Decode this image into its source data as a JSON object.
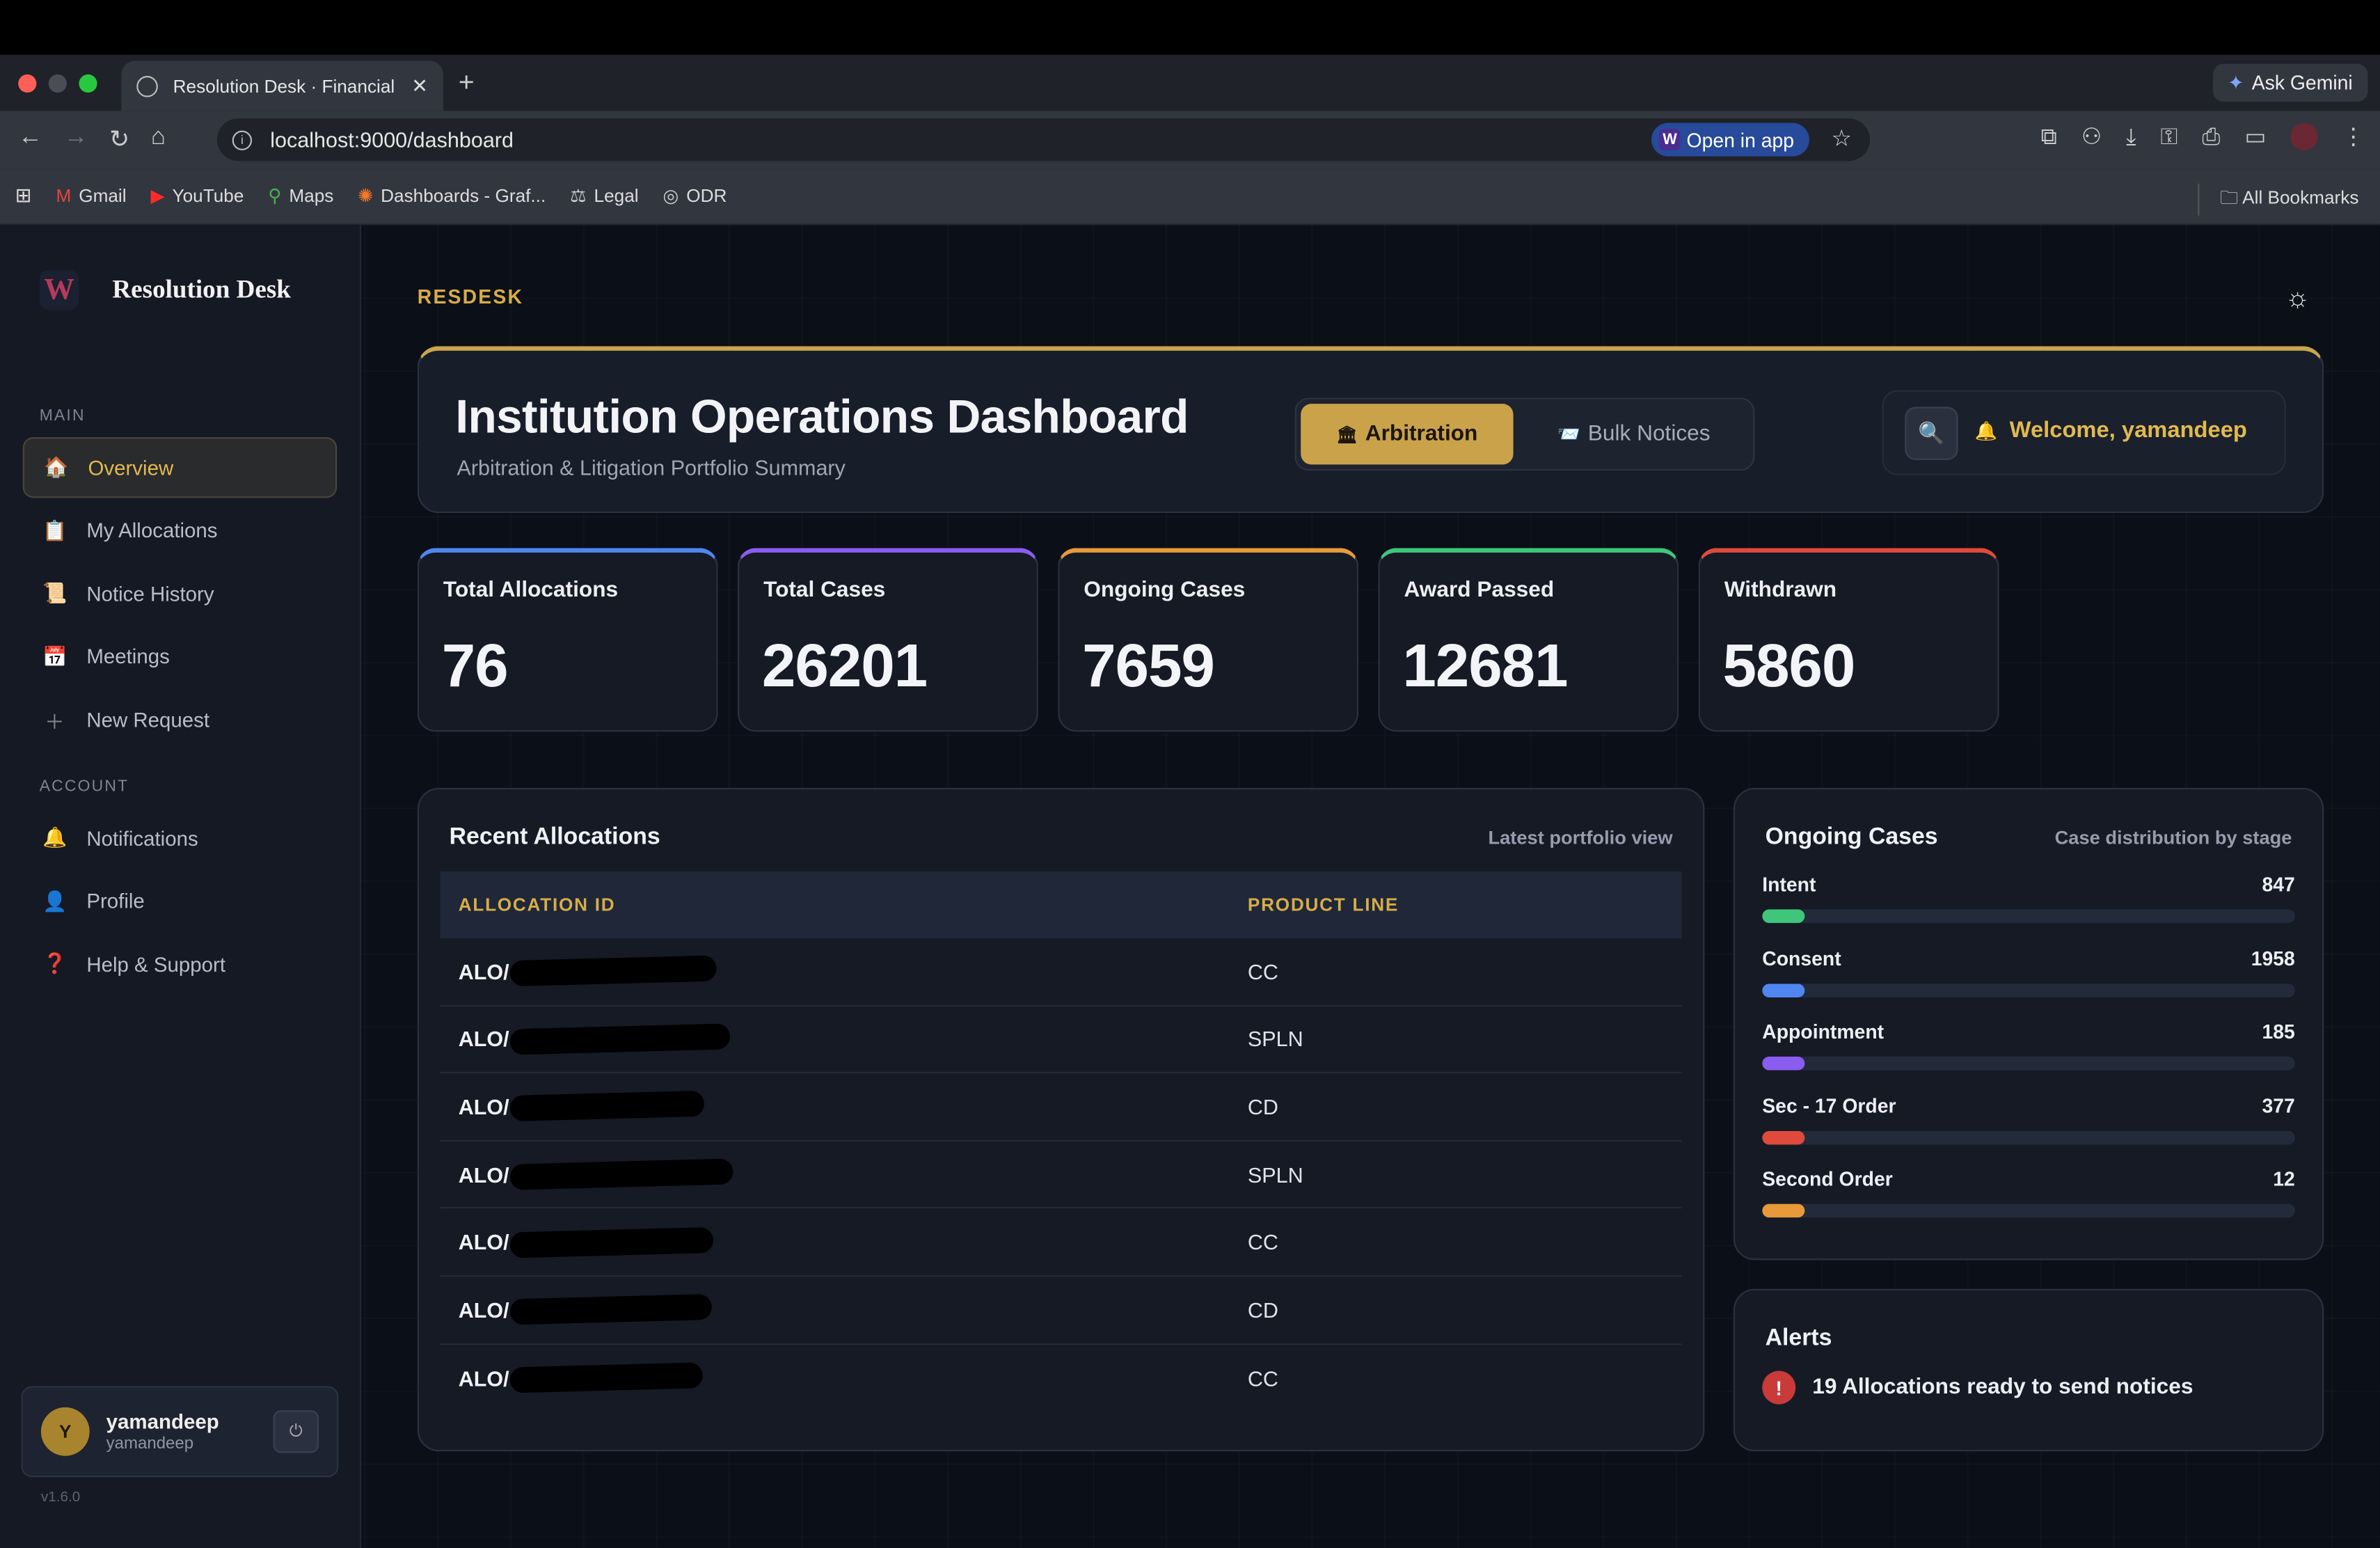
{
  "browser": {
    "tab_title": "Resolution Desk · Financial In",
    "url": "localhost:9000/dashboard",
    "open_in_app": "Open in app",
    "ask_gemini": "Ask Gemini",
    "bookmarks": [
      {
        "label": "Gmail",
        "icon": "gmail-icon"
      },
      {
        "label": "YouTube",
        "icon": "youtube-icon"
      },
      {
        "label": "Maps",
        "icon": "maps-icon"
      },
      {
        "label": "Dashboards - Graf...",
        "icon": "grafana-icon"
      },
      {
        "label": "Legal",
        "icon": "legal-icon"
      },
      {
        "label": "ODR",
        "icon": "odr-icon"
      }
    ],
    "all_bookmarks": "All Bookmarks"
  },
  "app": {
    "brand": "Resolution Desk",
    "logo_letter": "W",
    "breadcrumb": "RESDESK",
    "version": "v1.6.0",
    "sidebar": {
      "main_label": "MAIN",
      "main": [
        {
          "label": "Overview",
          "icon": "home-icon",
          "active": true
        },
        {
          "label": "My Allocations",
          "icon": "clipboard-icon"
        },
        {
          "label": "Notice History",
          "icon": "scroll-icon"
        },
        {
          "label": "Meetings",
          "icon": "calendar-icon"
        },
        {
          "label": "New Request",
          "icon": "plus-icon"
        }
      ],
      "account_label": "ACCOUNT",
      "account": [
        {
          "label": "Notifications",
          "icon": "bell-icon"
        },
        {
          "label": "Profile",
          "icon": "person-icon"
        },
        {
          "label": "Help & Support",
          "icon": "question-icon"
        }
      ]
    },
    "user": {
      "initial": "Y",
      "name": "yamandeep",
      "handle": "yamandeep"
    },
    "hero": {
      "title": "Institution Operations Dashboard",
      "subtitle": "Arbitration & Litigation Portfolio Summary",
      "tab_arbitration": "Arbitration",
      "tab_bulk": "Bulk Notices",
      "welcome": "Welcome, yamandeep"
    },
    "stats": [
      {
        "label": "Total Allocations",
        "value": "76",
        "color": "#4f86f0"
      },
      {
        "label": "Total Cases",
        "value": "26201",
        "color": "#8a5cf0"
      },
      {
        "label": "Ongoing Cases",
        "value": "7659",
        "color": "#e89a3a"
      },
      {
        "label": "Award Passed",
        "value": "12681",
        "color": "#3fc67a"
      },
      {
        "label": "Withdrawn",
        "value": "5860",
        "color": "#df4a3c"
      }
    ],
    "recent": {
      "title": "Recent Allocations",
      "note": "Latest portfolio view",
      "col_id": "ALLOCATION ID",
      "col_product": "PRODUCT LINE",
      "rows": [
        {
          "id": "ALO/",
          "product": "CC"
        },
        {
          "id": "ALO/",
          "product": "SPLN"
        },
        {
          "id": "ALO/",
          "product": "CD"
        },
        {
          "id": "ALO/",
          "product": "SPLN"
        },
        {
          "id": "ALO/",
          "product": "CC"
        },
        {
          "id": "ALO/",
          "product": "CD"
        },
        {
          "id": "ALO/",
          "product": "CC"
        }
      ]
    },
    "ongoing": {
      "title": "Ongoing Cases",
      "note": "Case distribution by stage",
      "stages": [
        {
          "label": "Intent",
          "value": "847",
          "color": "#3fc67a",
          "fill": 0.08
        },
        {
          "label": "Consent",
          "value": "1958",
          "color": "#4f86f0",
          "fill": 0.08
        },
        {
          "label": "Appointment",
          "value": "185",
          "color": "#8a5cf0",
          "fill": 0.08
        },
        {
          "label": "Sec - 17 Order",
          "value": "377",
          "color": "#df4a3c",
          "fill": 0.08
        },
        {
          "label": "Second Order",
          "value": "12",
          "color": "#e89a3a",
          "fill": 0.08
        }
      ]
    },
    "alerts": {
      "title": "Alerts",
      "message": "19 Allocations ready to send notices"
    }
  }
}
